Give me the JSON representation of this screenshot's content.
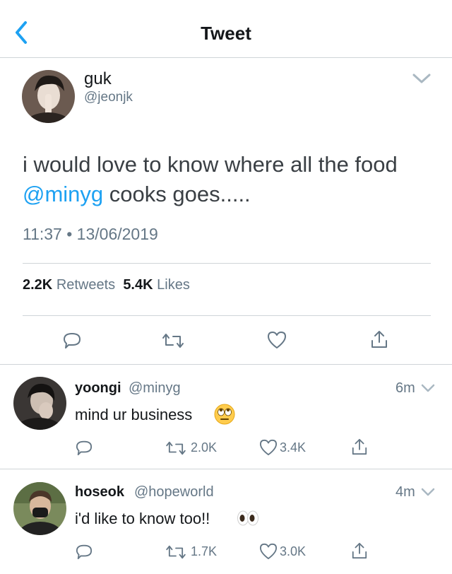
{
  "header": {
    "title": "Tweet"
  },
  "tweet": {
    "name": "guk",
    "handle": "@jeonjk",
    "text_before": "i would love to know where all the food ",
    "mention": "@minyg",
    "text_after": " cooks goes.....",
    "timestamp": "11:37 • 13/06/2019",
    "retweets_count": "2.2K",
    "retweets_label": "Retweets",
    "likes_count": "5.4K",
    "likes_label": "Likes"
  },
  "replies": [
    {
      "name": "yoongi",
      "handle": "@minyg",
      "time": "6m",
      "text": "mind ur business",
      "emoji": "face-with-rolling-eyes",
      "retweets": "2.0K",
      "likes": "3.4K"
    },
    {
      "name": "hoseok",
      "handle": "@hopeworld",
      "time": "4m",
      "text": "i'd like to know too!!",
      "emoji": "eyes",
      "retweets": "1.7K",
      "likes": "3.0K"
    }
  ],
  "colors": {
    "accent": "#1da1f2",
    "secondary_text": "#657786",
    "primary_text": "#14171a",
    "divider": "#cfd4d8"
  }
}
